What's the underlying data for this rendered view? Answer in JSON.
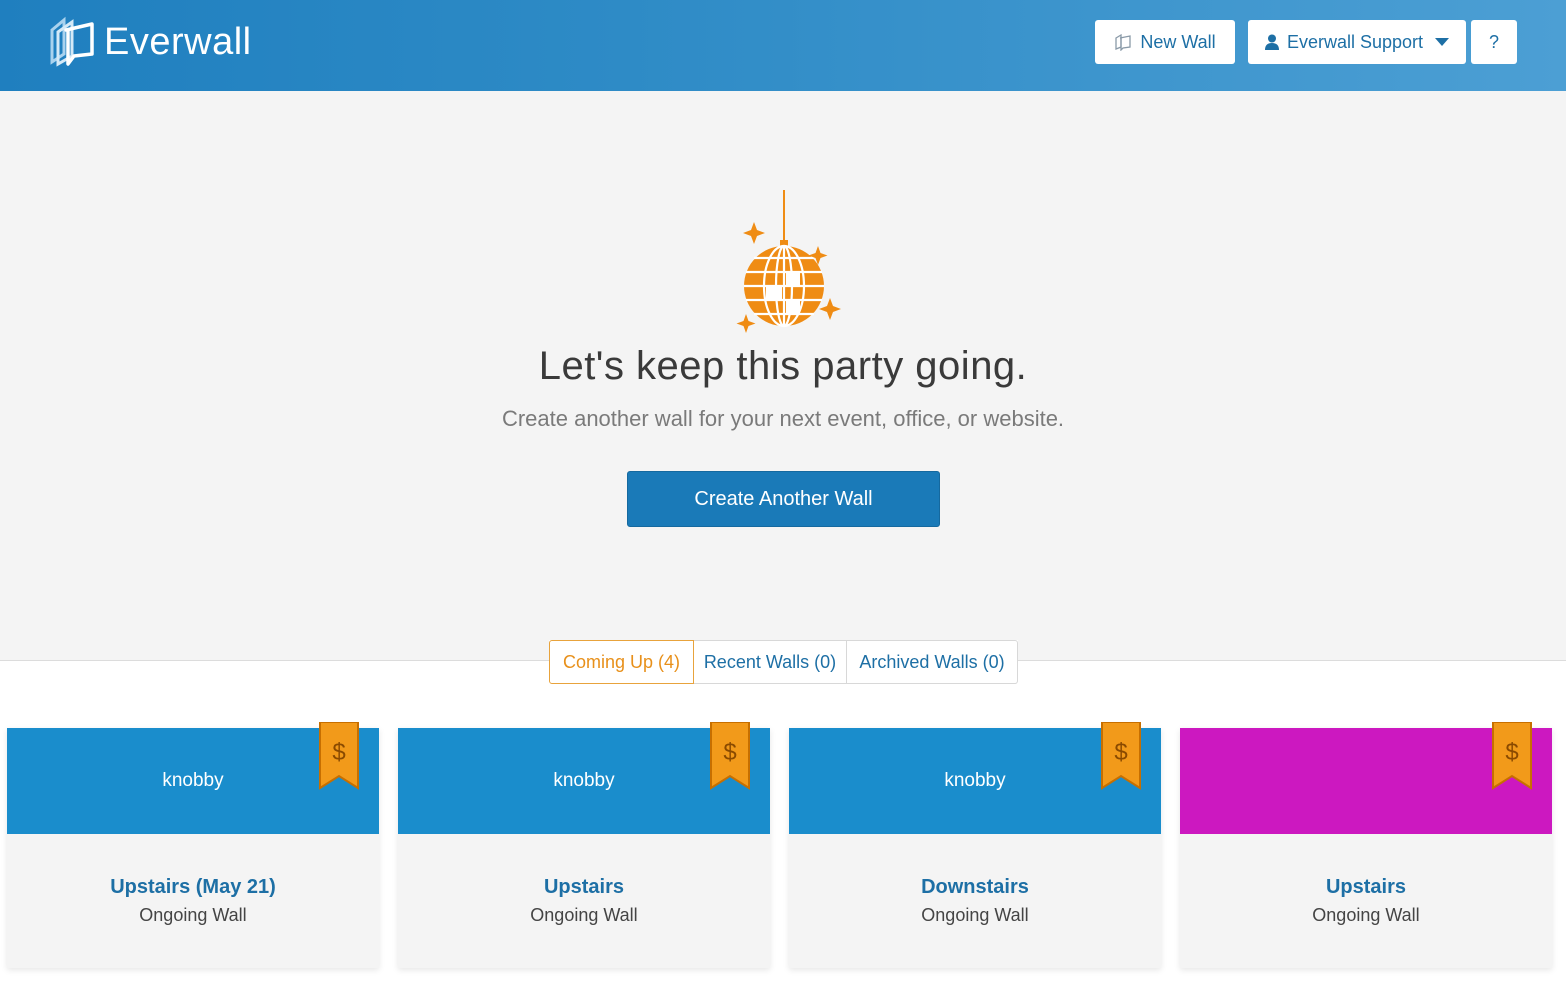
{
  "header": {
    "brand": "Everwall",
    "new_wall_label": "New Wall",
    "account_label": "Everwall Support",
    "help_label": "?"
  },
  "hero": {
    "icon": "disco-ball-icon",
    "title": "Let's keep this party going.",
    "subtitle": "Create another wall for your next event, office, or website.",
    "cta_label": "Create Another Wall"
  },
  "tabs": [
    {
      "label": "Coming Up (4)",
      "active": true
    },
    {
      "label": "Recent Walls (0)",
      "active": false
    },
    {
      "label": "Archived Walls (0)",
      "active": false
    }
  ],
  "cards": [
    {
      "banner_text": "knobby",
      "banner_color": "#1a8dcc",
      "title": "Upstairs (May 21)",
      "type": "Ongoing Wall",
      "badge": "$"
    },
    {
      "banner_text": "knobby",
      "banner_color": "#1a8dcc",
      "title": "Upstairs",
      "type": "Ongoing Wall",
      "badge": "$"
    },
    {
      "banner_text": "knobby",
      "banner_color": "#1a8dcc",
      "title": "Downstairs",
      "type": "Ongoing Wall",
      "badge": "$"
    },
    {
      "banner_text": "",
      "banner_color": "#cc18c0",
      "title": "Upstairs",
      "type": "Ongoing Wall",
      "badge": "$"
    }
  ],
  "colors": {
    "accent": "#1a7ab8",
    "orange": "#ef8c14",
    "link": "#1d6fa5"
  }
}
